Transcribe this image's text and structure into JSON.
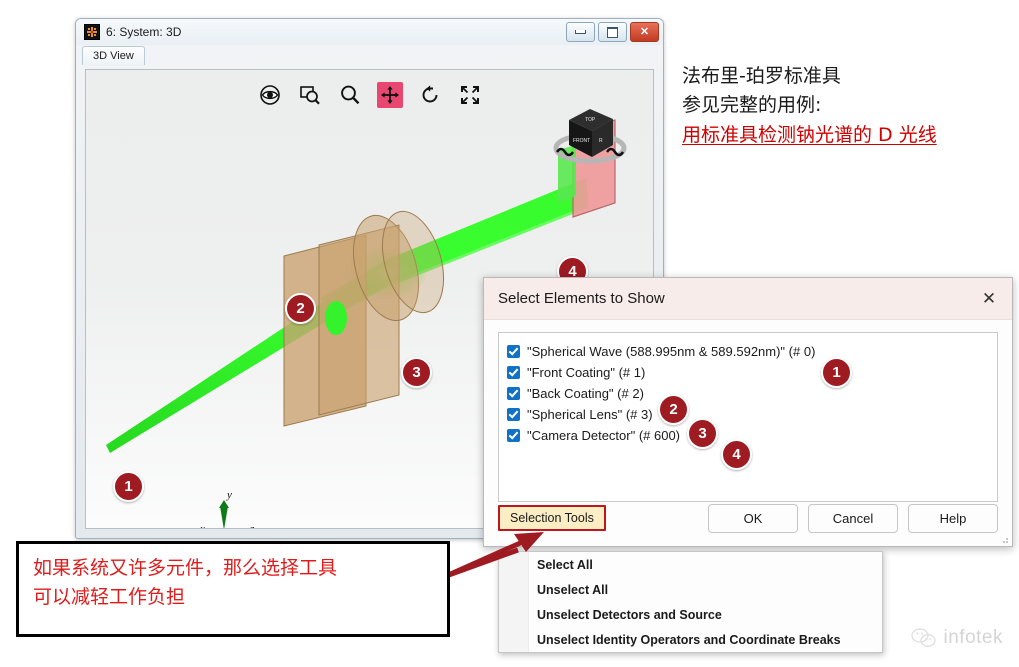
{
  "window": {
    "title": "6: System: 3D",
    "icon": "app-starburst-icon",
    "tab": "3D View",
    "controls": {
      "minimize": "minimize-icon",
      "maximize": "maximize-icon",
      "close": "close-icon"
    }
  },
  "viewport": {
    "tools": [
      {
        "name": "eye-icon",
        "label": "Eye",
        "active": false
      },
      {
        "name": "zoom-window-icon",
        "label": "Zoom Window",
        "active": false
      },
      {
        "name": "magnifier-icon",
        "label": "Zoom",
        "active": false
      },
      {
        "name": "pan-icon",
        "label": "Pan",
        "active": true
      },
      {
        "name": "rotate-icon",
        "label": "Rotate",
        "active": false
      },
      {
        "name": "fit-screen-icon",
        "label": "Fit",
        "active": false
      }
    ],
    "active_tool_color": "#e8476f",
    "nav_cube": "navigation-cube-icon",
    "axes": {
      "x": "x",
      "y": "y",
      "z": "z"
    },
    "callout_bubbles": [
      "1",
      "2",
      "3",
      "4"
    ],
    "beam_color": "#2bec22",
    "detector_color": "#ef9a9a",
    "element_color": "#c9a373"
  },
  "dialog": {
    "title": "Select Elements to Show",
    "close_icon": "close-icon",
    "items": [
      {
        "label": "\"Spherical Wave (588.995nm & 589.592nm)\" (# 0)",
        "checked": true
      },
      {
        "label": "\"Front Coating\" (# 1)",
        "checked": true
      },
      {
        "label": "\"Back Coating\" (# 2)",
        "checked": true
      },
      {
        "label": "\"Spherical Lens\" (# 3)",
        "checked": true
      },
      {
        "label": "\"Camera Detector\" (# 600)",
        "checked": true
      }
    ],
    "bubbles": [
      "1",
      "2",
      "3",
      "4"
    ],
    "selection_tools_label": "Selection Tools",
    "buttons": {
      "ok": "OK",
      "cancel": "Cancel",
      "help": "Help"
    },
    "highlight_color": "#c0151c"
  },
  "menu": {
    "items": [
      "Select All",
      "Unselect All",
      "Unselect Detectors and Source",
      "Unselect Identity Operators and Coordinate Breaks"
    ]
  },
  "annotations": {
    "right_note": {
      "line1": "法布里-珀罗标准具",
      "line2": "参见完整的用例:",
      "link": "用标准具检测钠光谱的 D 光线",
      "link_color": "#d00000"
    },
    "callout": {
      "line1": "如果系统又许多元件，那么选择工具",
      "line2": "可以减轻工作负担",
      "text_color": "#e01b1b",
      "arrow": "pointer-arrow-icon"
    }
  },
  "watermark": {
    "logo": "wechat-icon",
    "text": "infotek"
  }
}
